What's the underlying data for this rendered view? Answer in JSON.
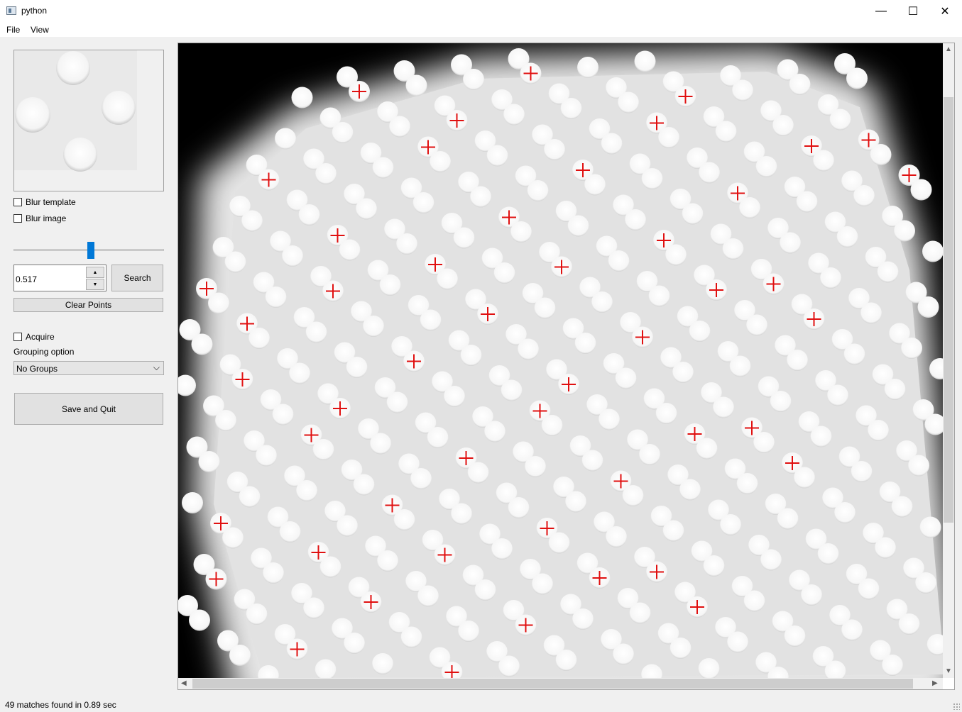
{
  "window": {
    "title": "python",
    "minimize_glyph": "—",
    "maximize_glyph": "☐",
    "close_glyph": "✕"
  },
  "menu": [
    "File",
    "View"
  ],
  "controls": {
    "blur_template_label": "Blur template",
    "blur_image_label": "Blur image",
    "blur_template_checked": false,
    "blur_image_checked": false,
    "threshold_value": "0.517",
    "slider_level": 0.517,
    "search_label": "Search",
    "clear_points_label": "Clear Points",
    "acquire_label": "Acquire",
    "acquire_checked": false,
    "grouping_label": "Grouping option",
    "grouping_selected": "No Groups",
    "save_quit_label": "Save and Quit"
  },
  "status": {
    "text": "49 matches found in 0.89 sec"
  },
  "icons": {
    "spin_up": "▲",
    "spin_down": "▼",
    "combo_arrow": "⌵",
    "scroll_up": "▲",
    "scroll_down": "▼",
    "scroll_left": "◀",
    "scroll_right": "▶"
  },
  "colors": {
    "marker": "#e01010",
    "slider": "#0078d7"
  }
}
